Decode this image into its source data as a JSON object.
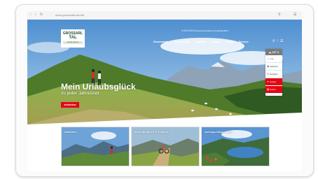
{
  "browser": {
    "url_host": "www.grossarltal.info",
    "url_path": "/de",
    "back_label": "‹",
    "forward_label": "›",
    "reload_label": "↻",
    "menu_label": "☰",
    "search_label": "⚲"
  },
  "topbar": {
    "text": "⚲  ⚀ ⚀ ⚀ ⚀ ⚀   Tourismusverband Grossarltal   DE ▾"
  },
  "logo": {
    "line1": "GROSSARL",
    "line2": "TAL",
    "tagline": "Tal der Almen"
  },
  "nav": {
    "items": [
      "Grossarltal",
      "Unterkünfte",
      "Sommer",
      "Winter",
      "Blog",
      "Service"
    ]
  },
  "nav_icons": {
    "search": "⚲",
    "heart": "♡",
    "menu": "☰"
  },
  "hero": {
    "headline": "Mein Urlaubsglück",
    "subline": "zu jeder Jahreszeit",
    "cta": "entdecken"
  },
  "widget": {
    "weather": "☁ 19° C",
    "items": [
      {
        "icon": "☺",
        "label": "Live"
      },
      {
        "icon": "▣",
        "label": "Webcams"
      },
      {
        "icon": "✉",
        "label": "Prospekte"
      },
      {
        "icon": "✦",
        "label": "Anfrage"
      },
      {
        "icon": "▤",
        "label": "Buchen"
      }
    ]
  },
  "cards": [
    {
      "title": "Wandern"
    },
    {
      "title": "Mountainbiken & E-Biken"
    },
    {
      "title": "Aufzugs-Wasserfälle"
    }
  ],
  "colors": {
    "accent": "#e30613",
    "logo_green": "#1f4d2e",
    "sky": "#5f9fd6",
    "meadow": "#7fa53a"
  }
}
